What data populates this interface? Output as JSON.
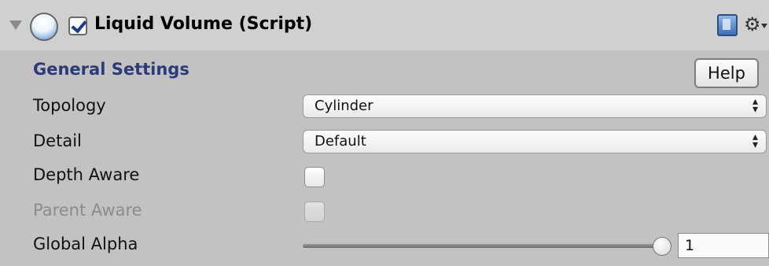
{
  "component": {
    "title": "Liquid Volume (Script)",
    "enabled": true,
    "foldout_icon": "foldout-triangle-icon",
    "script_icon": "liquid-sphere-icon",
    "reference_icon": "book-icon",
    "settings_icon": "gear-icon"
  },
  "section": {
    "title": "General Settings",
    "help_label": "Help"
  },
  "fields": {
    "topology": {
      "label": "Topology",
      "value": "Cylinder"
    },
    "detail": {
      "label": "Detail",
      "value": "Default"
    },
    "depth_aware": {
      "label": "Depth Aware",
      "checked": false
    },
    "parent_aware": {
      "label": "Parent Aware",
      "checked": false,
      "disabled": true
    },
    "global_alpha": {
      "label": "Global Alpha",
      "value": "1",
      "slider_fraction": 1.0
    }
  },
  "colors": {
    "section_title": "#2a3a7a",
    "background": "#c2c2c2",
    "header": "#d0d0d0"
  }
}
